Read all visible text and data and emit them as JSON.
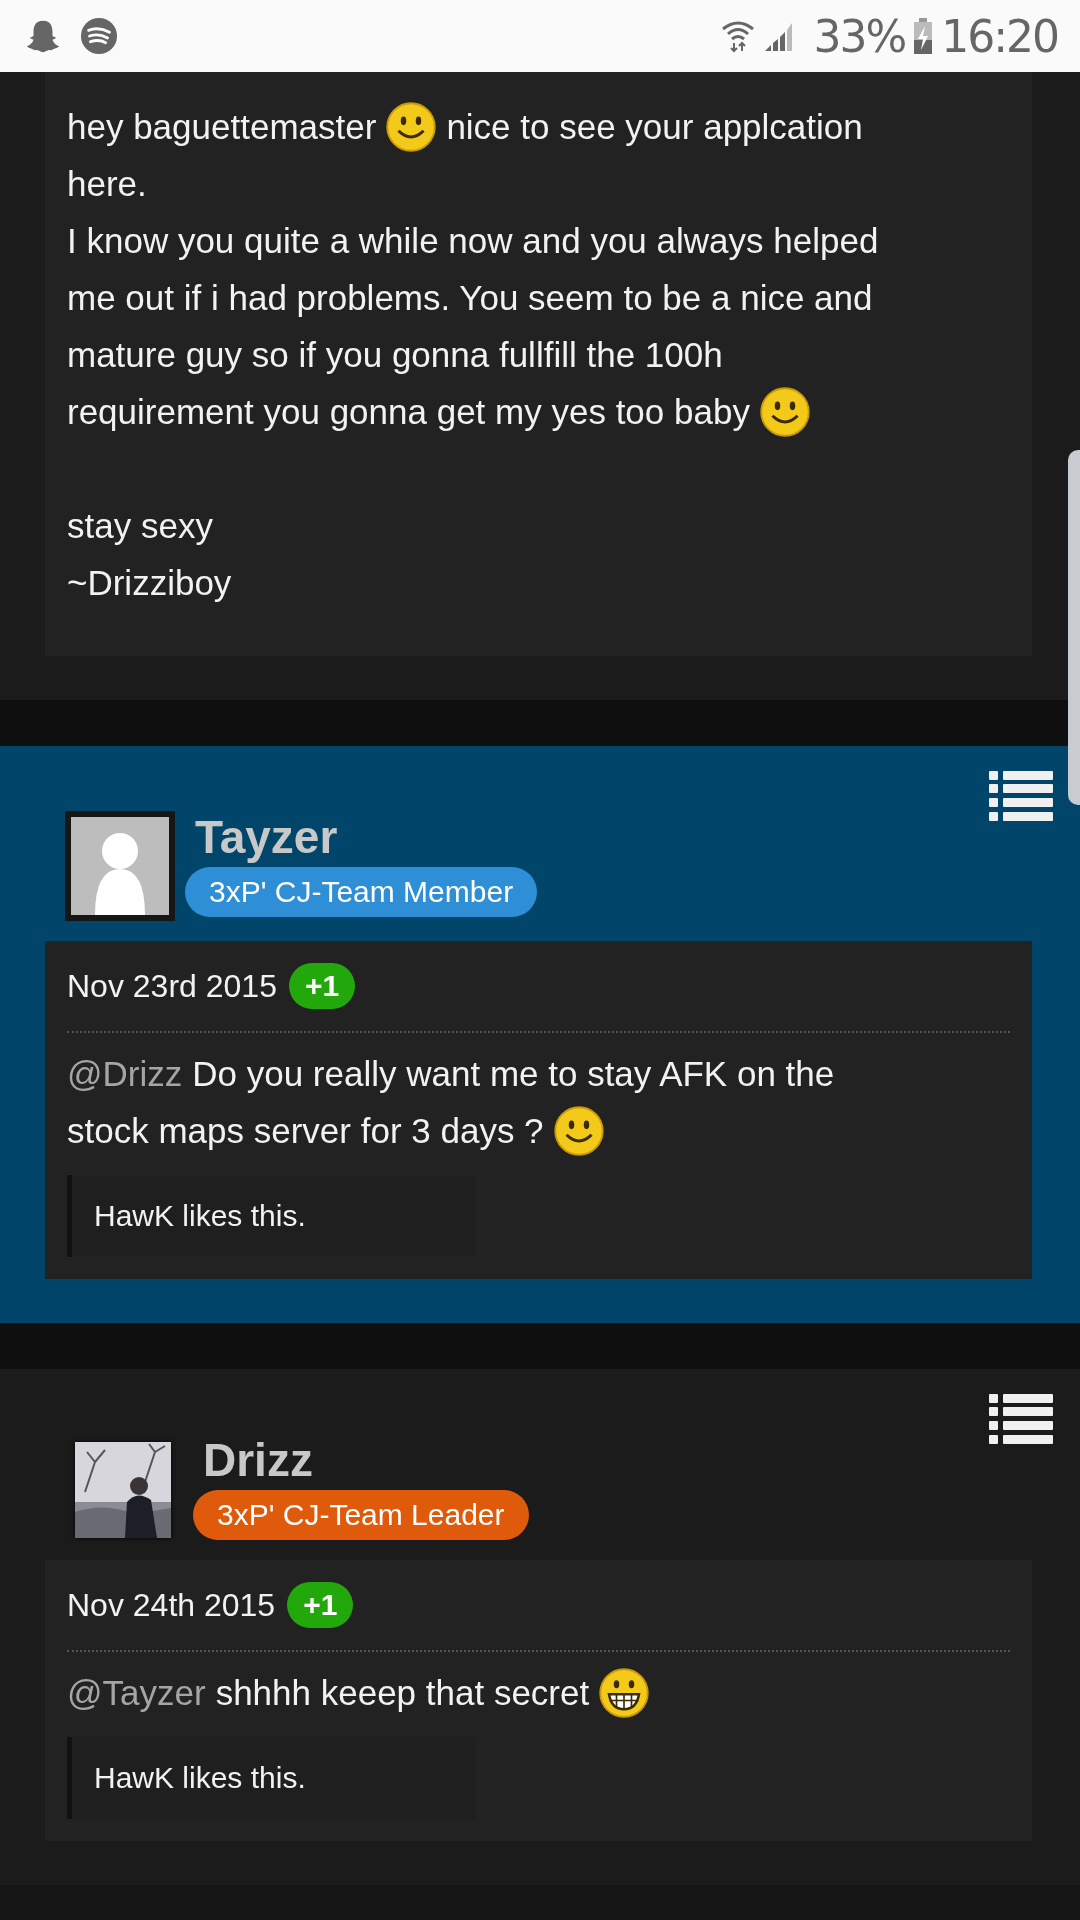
{
  "status_bar": {
    "battery": "33%",
    "time": "16:20"
  },
  "posts": [
    {
      "kind": "continued",
      "highlighted": false,
      "lines": [
        [
          {
            "kind": "text",
            "text": "hey baguettemaster"
          },
          {
            "kind": "smiley"
          },
          {
            "kind": "text",
            "text": "nice to see your applcation"
          }
        ],
        [
          {
            "kind": "text",
            "text": "here."
          }
        ],
        [
          {
            "kind": "text",
            "text": "I know you quite a while now and you always helped"
          }
        ],
        [
          {
            "kind": "text",
            "text": "me out if i had problems. You seem to be a nice and"
          }
        ],
        [
          {
            "kind": "text",
            "text": "mature guy so if you gonna fullfill the 100h"
          }
        ],
        [
          {
            "kind": "text",
            "text": "requirement you gonna get my yes too baby"
          },
          {
            "kind": "smiley"
          }
        ],
        [
          {
            "kind": "blank"
          }
        ],
        [
          {
            "kind": "text",
            "text": "stay sexy"
          }
        ],
        [
          {
            "kind": "text",
            "text": "~Drizziboy"
          }
        ]
      ]
    },
    {
      "kind": "full",
      "highlighted": true,
      "avatar": {
        "kind": "silhouette"
      },
      "author": "Tayzer",
      "rank": {
        "text": "3xP' CJ-Team Member",
        "color": "#2f8fd6"
      },
      "date": "Nov 23rd 2015",
      "vote": "+1",
      "lines": [
        [
          {
            "kind": "mention",
            "text": "@Drizz"
          },
          {
            "kind": "text",
            "text": "Do you really want me to stay AFK on the"
          }
        ],
        [
          {
            "kind": "text",
            "text": "stock maps server for 3 days ?"
          },
          {
            "kind": "smiley"
          }
        ]
      ],
      "likes": "HawK likes this."
    },
    {
      "kind": "full",
      "highlighted": false,
      "avatar": {
        "kind": "picture"
      },
      "author": "Drizz",
      "rank": {
        "text": "3xP' CJ-Team Leader",
        "color": "#e05a0c"
      },
      "date": "Nov 24th 2015",
      "vote": "+1",
      "lines": [
        [
          {
            "kind": "mention",
            "text": "@Tayzer"
          },
          {
            "kind": "text",
            "text": "shhhh keeep that secret"
          },
          {
            "kind": "grin"
          }
        ]
      ],
      "likes": "HawK likes this."
    }
  ]
}
